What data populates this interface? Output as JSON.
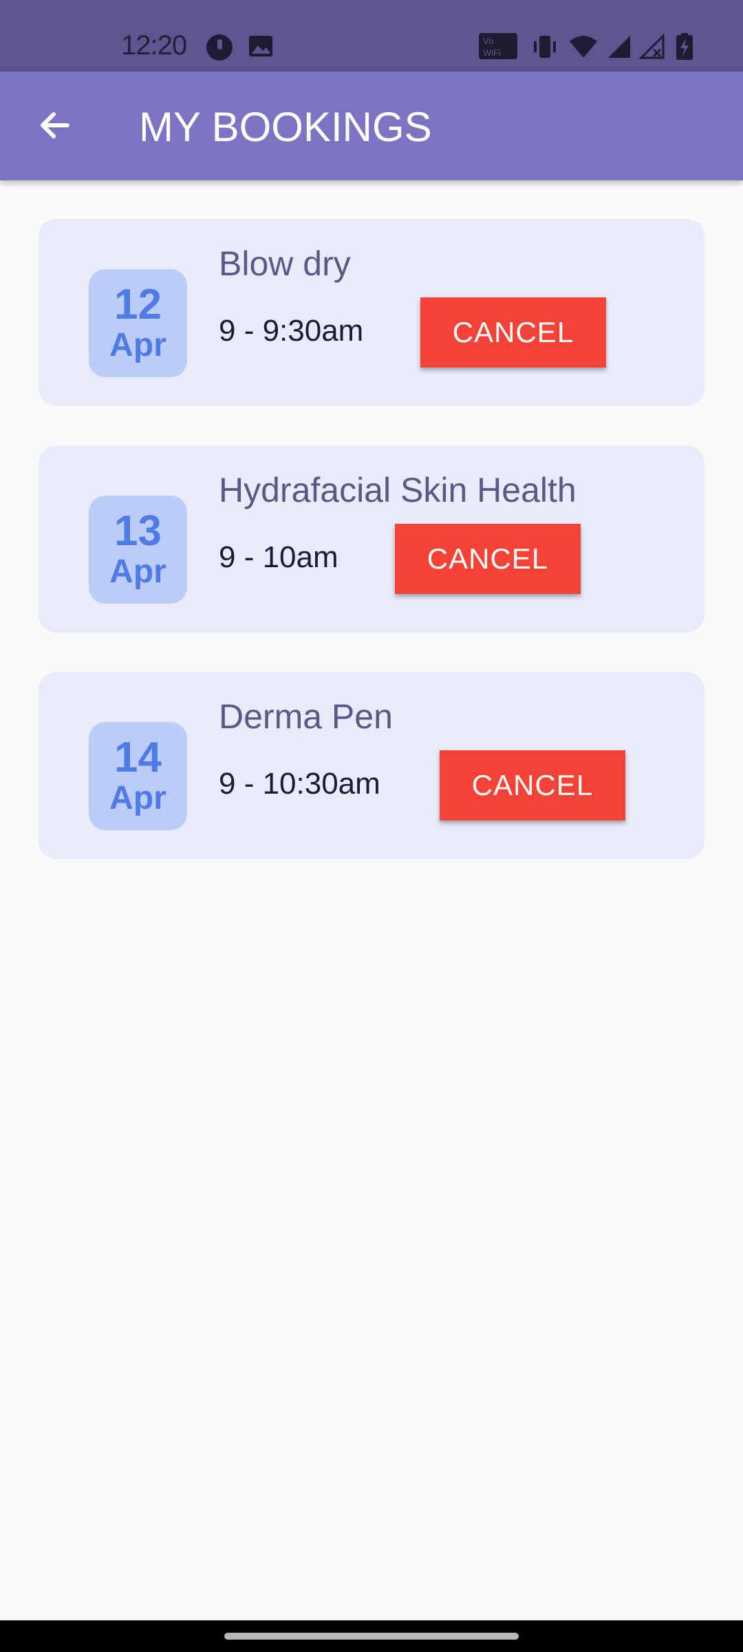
{
  "status_bar": {
    "time": "12:20",
    "left_icons": [
      "circle-app-icon",
      "image-icon"
    ],
    "right_icons": [
      "vowifi-icon",
      "vibrate-icon",
      "wifi-icon",
      "signal-icon",
      "signal-off-icon",
      "battery-charging-icon"
    ]
  },
  "app_bar": {
    "title": "MY BOOKINGS",
    "background": "#7b74c2",
    "back_icon": "arrow-back-icon"
  },
  "bookings": [
    {
      "day": "12",
      "month": "Apr",
      "service": "Blow dry",
      "time": "9 - 9:30am",
      "action_label": "CANCEL"
    },
    {
      "day": "13",
      "month": "Apr",
      "service": "Hydrafacial Skin Health",
      "time": "9 - 10am",
      "action_label": "CANCEL"
    },
    {
      "day": "14",
      "month": "Apr",
      "service": "Derma Pen",
      "time": "9 - 10:30am",
      "action_label": "CANCEL"
    }
  ],
  "colors": {
    "accent": "#7b74c2",
    "cancel": "#f44336",
    "card": "#e7ecf8",
    "date_badge": "#bcccf9",
    "date_text": "#4f7be6"
  }
}
